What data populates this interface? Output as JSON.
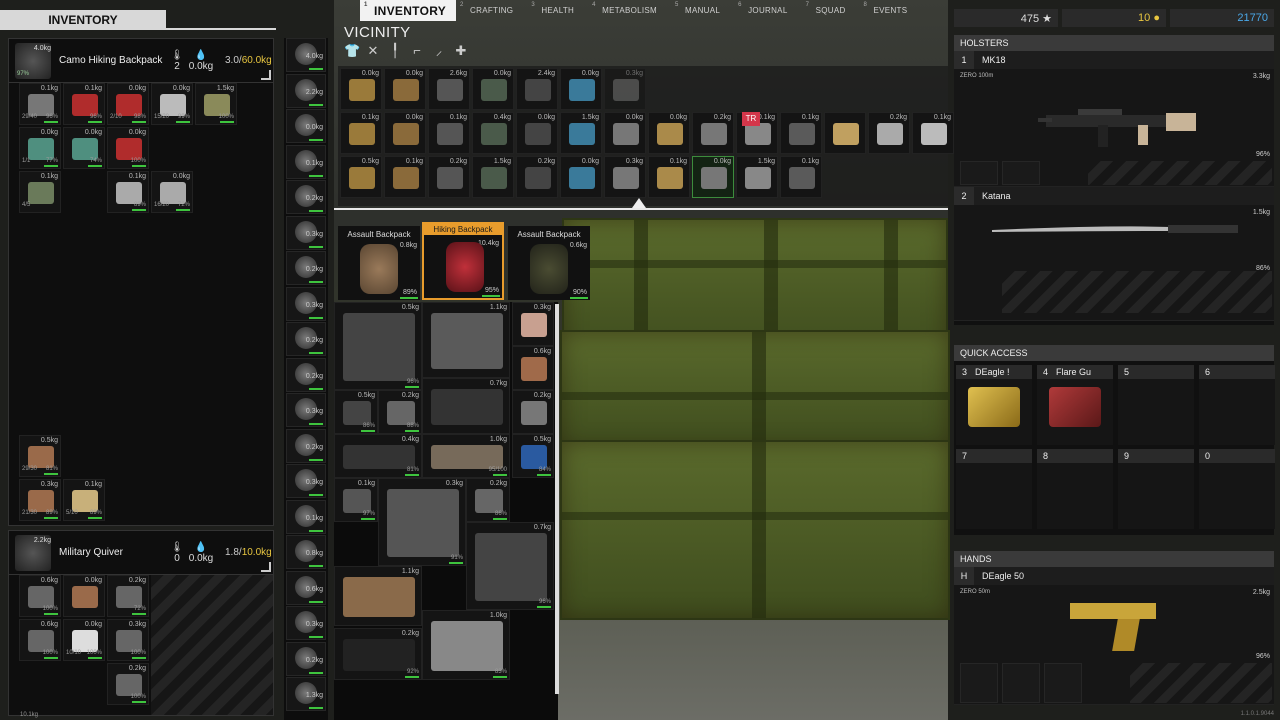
{
  "nav": {
    "tabs": [
      {
        "num": "1",
        "label": "INVENTORY"
      },
      {
        "num": "2",
        "label": "CRAFTING"
      },
      {
        "num": "3",
        "label": "HEALTH"
      },
      {
        "num": "4",
        "label": "METABOLISM"
      },
      {
        "num": "5",
        "label": "MANUAL"
      },
      {
        "num": "6",
        "label": "JOURNAL"
      },
      {
        "num": "7",
        "label": "SQUAD"
      },
      {
        "num": "8",
        "label": "EVENTS"
      }
    ],
    "active": "INVENTORY"
  },
  "left": {
    "title": "INVENTORY",
    "backpack": {
      "name": "Camo Hiking Backpack",
      "weight": "4.0kg",
      "temp": "2",
      "wet": "0.0kg",
      "cap_used": "3.0",
      "cap_max": "60.0kg",
      "condition": "97%"
    },
    "quiver": {
      "name": "Military Quiver",
      "weight": "2.2kg",
      "temp": "0",
      "wet": "0.0kg",
      "cap_used": "1.8",
      "cap_max": "10.0kg"
    },
    "backpack_items": [
      {
        "w": "0.1kg",
        "q": "29/40",
        "c": "96%"
      },
      {
        "w": "0.1kg",
        "q": "",
        "c": "96%"
      },
      {
        "w": "0.0kg",
        "q": "2/10",
        "c": "98%"
      },
      {
        "w": "0.0kg",
        "q": "15/20",
        "c": "99%"
      },
      {
        "w": "1.5kg",
        "q": "",
        "c": "100%"
      },
      {
        "w": "0.0kg",
        "q": "1/1",
        "c": "77%"
      },
      {
        "w": "0.0kg",
        "q": "",
        "c": "74%"
      },
      {
        "w": "0.0kg",
        "q": "",
        "c": "100%"
      },
      {
        "w": "0.1kg",
        "q": "4/5",
        "c": ""
      },
      {
        "w": "0.1kg",
        "q": "",
        "c": "89%"
      },
      {
        "w": "0.0kg",
        "q": "16/20",
        "c": "72%"
      },
      {
        "w": "0.5kg",
        "q": "29/30",
        "c": "81%"
      },
      {
        "w": "0.3kg",
        "q": "21/30",
        "c": "89%"
      },
      {
        "w": "0.1kg",
        "q": "5/10",
        "c": "89%"
      }
    ],
    "quiver_items": [
      {
        "w": "0.6kg",
        "q": "",
        "c": "100%"
      },
      {
        "w": "0.0kg",
        "q": "",
        "c": ""
      },
      {
        "w": "0.2kg",
        "q": "",
        "c": "72%"
      },
      {
        "w": "0.6kg",
        "q": "",
        "c": "100%"
      },
      {
        "w": "0.0kg",
        "q": "10/10",
        "c": "100%"
      },
      {
        "w": "0.3kg",
        "q": "",
        "c": "100%"
      },
      {
        "w": "0.2kg",
        "q": "",
        "c": "100%"
      }
    ],
    "bottom_weight": "10.1kg"
  },
  "equipment": [
    "4.0kg",
    "2.2kg",
    "0.0kg",
    "0.1kg",
    "0.2kg",
    "0.3kg",
    "0.2kg",
    "0.3kg",
    "0.2kg",
    "0.2kg",
    "0.3kg",
    "0.2kg",
    "0.3kg",
    "0.1kg",
    "0.8kg",
    "0.6kg",
    "0.3kg",
    "0.2kg",
    "1.3kg"
  ],
  "vicinity": {
    "title": "VICINITY",
    "tools": [
      "shirt-icon",
      "cross-icon",
      "pipe-icon",
      "gun-icon",
      "pickaxe-icon",
      "plus-icon"
    ],
    "row1": [
      "0.0kg",
      "0.0kg",
      "2.6kg",
      "0.0kg",
      "2.4kg",
      "0.0kg",
      "0.3kg"
    ],
    "row2": [
      "0.1kg",
      "0.0kg",
      "0.1kg",
      "0.4kg",
      "0.0kg",
      "1.5kg",
      "0.0kg",
      "0.0kg",
      "0.2kg",
      "0.1kg",
      "0.1kg",
      "",
      "0.2kg",
      "0.1kg"
    ],
    "row3": [
      "0.5kg",
      "0.1kg",
      "0.2kg",
      "1.5kg",
      "0.2kg",
      "0.0kg",
      "0.3kg",
      "0.1kg",
      "0.0kg",
      "1.5kg",
      "0.1kg"
    ],
    "tr_badge": "TR",
    "bags": [
      {
        "name": "Assault Backpack",
        "w": "0.8kg",
        "c": "89%"
      },
      {
        "name": "Hiking Backpack",
        "w": "10.4kg",
        "c": "95%"
      },
      {
        "name": "Assault Backpack",
        "w": "0.6kg",
        "c": "90%"
      }
    ],
    "bag_items": [
      {
        "w": "0.5kg",
        "c": "96%"
      },
      {
        "w": "1.1kg",
        "c": ""
      },
      {
        "w": "0.3kg",
        "c": ""
      },
      {
        "w": "0.6kg",
        "c": ""
      },
      {
        "w": "0.7kg",
        "c": ""
      },
      {
        "w": "0.5kg",
        "c": "86%"
      },
      {
        "w": "0.2kg",
        "c": "88%"
      },
      {
        "w": "0.2kg",
        "c": ""
      },
      {
        "w": "0.4kg",
        "c": "81%"
      },
      {
        "w": "1.0kg",
        "c": "95/100"
      },
      {
        "w": "0.5kg",
        "c": "84%"
      },
      {
        "w": "0.1kg",
        "c": "97%"
      },
      {
        "w": "0.3kg",
        "c": "91%"
      },
      {
        "w": "0.2kg",
        "c": "86%"
      },
      {
        "w": "0.7kg",
        "c": "96%"
      },
      {
        "w": "1.1kg",
        "c": ""
      },
      {
        "w": "0.2kg",
        "c": "92%"
      },
      {
        "w": "1.0kg",
        "c": "83%"
      }
    ]
  },
  "right": {
    "stats": {
      "score": "475 ★",
      "gold": "10",
      "money": "21770"
    },
    "holsters": {
      "title": "HOLSTERS",
      "slots": [
        {
          "num": "1",
          "name": "MK18",
          "zero": "ZERO 100m",
          "w": "3.3kg",
          "c": "96%"
        },
        {
          "num": "2",
          "name": "Katana",
          "zero": "",
          "w": "1.5kg",
          "c": "86%"
        }
      ]
    },
    "quick": {
      "title": "QUICK ACCESS",
      "slots": [
        {
          "num": "3",
          "name": "DEagle !"
        },
        {
          "num": "4",
          "name": "Flare Gu"
        },
        {
          "num": "5",
          "name": ""
        },
        {
          "num": "6",
          "name": ""
        },
        {
          "num": "7",
          "name": ""
        },
        {
          "num": "8",
          "name": ""
        },
        {
          "num": "9",
          "name": ""
        },
        {
          "num": "0",
          "name": ""
        }
      ]
    },
    "hands": {
      "title": "HANDS",
      "num": "H",
      "name": "DEagle 50",
      "zero": "ZERO 50m",
      "w": "2.5kg",
      "c": "96%"
    },
    "version": "1.1.0.1.9044"
  },
  "colors": {
    "accent_orange": "#e89c2c",
    "condition_green": "#3ec43e",
    "capacity_yellow": "#e8c640",
    "money_blue": "#4aa8e8"
  }
}
